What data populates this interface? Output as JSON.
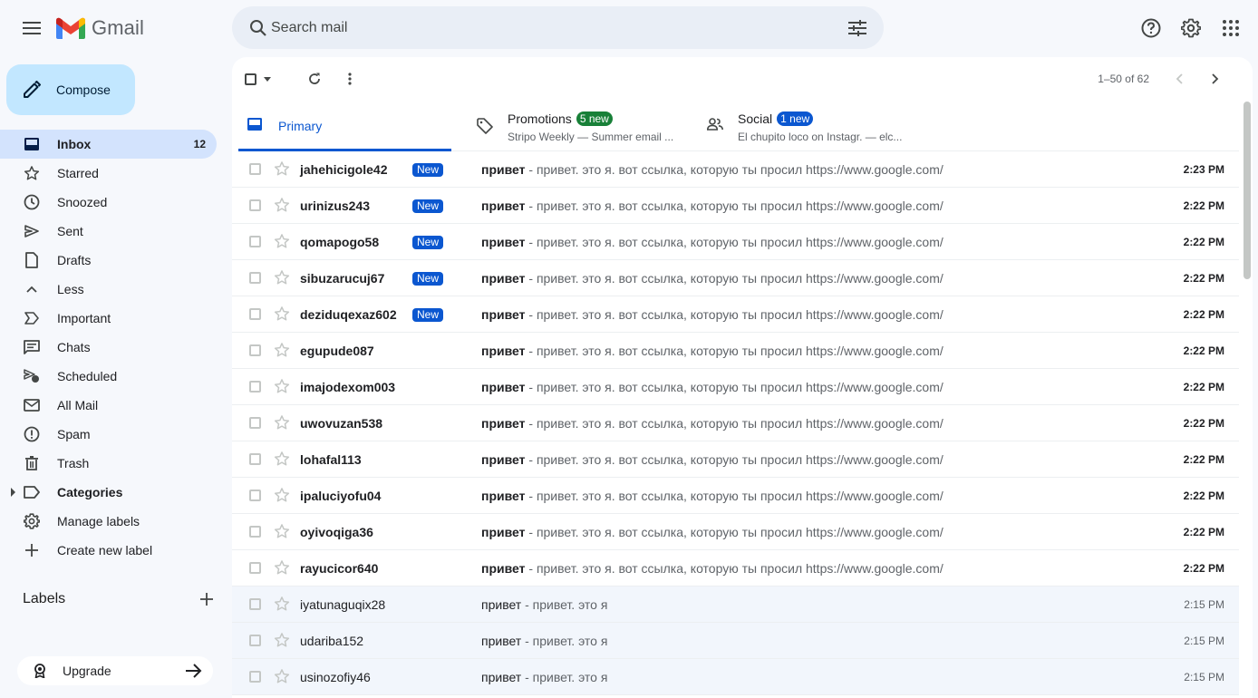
{
  "app": {
    "name": "Gmail"
  },
  "search": {
    "placeholder": "Search mail"
  },
  "compose": {
    "label": "Compose"
  },
  "sidebar": {
    "items": [
      {
        "label": "Inbox",
        "count": "12",
        "icon": "inbox-icon"
      },
      {
        "label": "Starred",
        "count": "",
        "icon": "star-icon"
      },
      {
        "label": "Snoozed",
        "count": "",
        "icon": "clock-icon"
      },
      {
        "label": "Sent",
        "count": "",
        "icon": "send-icon"
      },
      {
        "label": "Drafts",
        "count": "",
        "icon": "draft-icon"
      },
      {
        "label": "Less",
        "count": "",
        "icon": "chevron-up-icon"
      },
      {
        "label": "Important",
        "count": "",
        "icon": "important-icon"
      },
      {
        "label": "Chats",
        "count": "",
        "icon": "chat-icon"
      },
      {
        "label": "Scheduled",
        "count": "",
        "icon": "scheduled-icon"
      },
      {
        "label": "All Mail",
        "count": "",
        "icon": "all-mail-icon"
      },
      {
        "label": "Spam",
        "count": "",
        "icon": "spam-icon"
      },
      {
        "label": "Trash",
        "count": "",
        "icon": "trash-icon"
      },
      {
        "label": "Categories",
        "count": "",
        "icon": "label-icon"
      },
      {
        "label": "Manage labels",
        "count": "",
        "icon": "gear-icon"
      },
      {
        "label": "Create new label",
        "count": "",
        "icon": "plus-icon"
      }
    ],
    "labels_heading": "Labels",
    "upgrade_label": "Upgrade"
  },
  "toolbar": {
    "pager": "1–50 of 62"
  },
  "tabs": {
    "primary": {
      "label": "Primary"
    },
    "promotions": {
      "label": "Promotions",
      "badge": "5 new",
      "snippet": "Stripo Weekly — Summer email ..."
    },
    "social": {
      "label": "Social",
      "badge": "1 new",
      "snippet": "El chupito loco on Instagr. — elc..."
    }
  },
  "emails": [
    {
      "sender": "jahehicigole42",
      "new": "New",
      "subject": "привет",
      "snippet": " - привет. это я. вот ссылка, которую ты просил https://www.google.com/",
      "time": "2:23 PM",
      "unread": true
    },
    {
      "sender": "urinizus243",
      "new": "New",
      "subject": "привет",
      "snippet": " - привет. это я. вот ссылка, которую ты просил https://www.google.com/",
      "time": "2:22 PM",
      "unread": true
    },
    {
      "sender": "qomapogo58",
      "new": "New",
      "subject": "привет",
      "snippet": " - привет. это я. вот ссылка, которую ты просил https://www.google.com/",
      "time": "2:22 PM",
      "unread": true
    },
    {
      "sender": "sibuzarucuj67",
      "new": "New",
      "subject": "привет",
      "snippet": " - привет. это я. вот ссылка, которую ты просил https://www.google.com/",
      "time": "2:22 PM",
      "unread": true
    },
    {
      "sender": "deziduqexaz602",
      "new": "New",
      "subject": "привет",
      "snippet": " - привет. это я. вот ссылка, которую ты просил https://www.google.com/",
      "time": "2:22 PM",
      "unread": true
    },
    {
      "sender": "egupude087",
      "new": "",
      "subject": "привет",
      "snippet": " - привет. это я. вот ссылка, которую ты просил https://www.google.com/",
      "time": "2:22 PM",
      "unread": true
    },
    {
      "sender": "imajodexom003",
      "new": "",
      "subject": "привет",
      "snippet": " - привет. это я. вот ссылка, которую ты просил https://www.google.com/",
      "time": "2:22 PM",
      "unread": true
    },
    {
      "sender": "uwovuzan538",
      "new": "",
      "subject": "привет",
      "snippet": " - привет. это я. вот ссылка, которую ты просил https://www.google.com/",
      "time": "2:22 PM",
      "unread": true
    },
    {
      "sender": "lohafal113",
      "new": "",
      "subject": "привет",
      "snippet": " - привет. это я. вот ссылка, которую ты просил https://www.google.com/",
      "time": "2:22 PM",
      "unread": true
    },
    {
      "sender": "ipaluciyofu04",
      "new": "",
      "subject": "привет",
      "snippet": " - привет. это я. вот ссылка, которую ты просил https://www.google.com/",
      "time": "2:22 PM",
      "unread": true
    },
    {
      "sender": "oyivoqiga36",
      "new": "",
      "subject": "привет",
      "snippet": " - привет. это я. вот ссылка, которую ты просил https://www.google.com/",
      "time": "2:22 PM",
      "unread": true
    },
    {
      "sender": "rayucicor640",
      "new": "",
      "subject": "привет",
      "snippet": " - привет. это я. вот ссылка, которую ты просил https://www.google.com/",
      "time": "2:22 PM",
      "unread": true
    },
    {
      "sender": "iyatunaguqix28",
      "new": "",
      "subject": "привет",
      "snippet": " - привет. это я",
      "time": "2:15 PM",
      "unread": false
    },
    {
      "sender": "udariba152",
      "new": "",
      "subject": "привет",
      "snippet": " - привет. это я",
      "time": "2:15 PM",
      "unread": false
    },
    {
      "sender": "usinozofiy46",
      "new": "",
      "subject": "привет",
      "snippet": " - привет. это я",
      "time": "2:15 PM",
      "unread": false
    }
  ],
  "colors": {
    "accent": "#0b57d0",
    "compose_bg": "#c2e7ff",
    "active_nav": "#d3e3fd",
    "promo_badge": "#188038"
  }
}
